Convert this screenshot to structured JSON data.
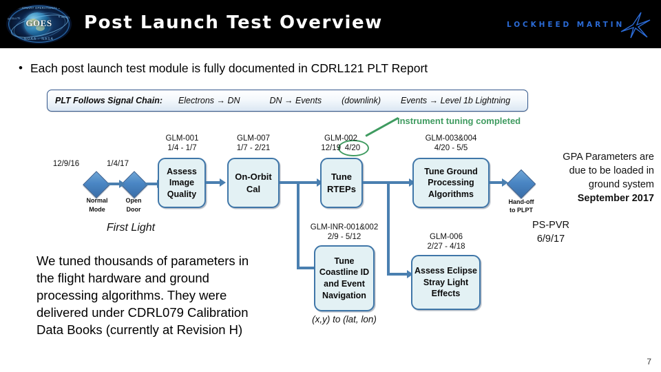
{
  "header": {
    "title": "Post Launch Test Overview",
    "logo_name": "GOES",
    "logo_arc_top": "GEOSTATIONARY  OPERATIONAL  ENVIRONMENTAL  SATELLITE",
    "logo_arc_bottom": "NOAA - NASA",
    "logo_side_left": "SATELLITE",
    "logo_side_right": "R SERIES",
    "brand": "LOCKHEED MARTIN",
    "background_color": "#000000",
    "brand_color": "#2b6bd6"
  },
  "bullet": {
    "marker": "•",
    "text": "Each post launch test module is fully documented in CDRL121 PLT Report"
  },
  "signal_chain": {
    "label": "PLT Follows Signal Chain:",
    "seg1": "Electrons → DN",
    "seg2": "DN → Events",
    "seg3": "(downlink)",
    "seg4": "Events → Level 1b Lightning",
    "border_color": "#33578c"
  },
  "annotation": {
    "instrument_tuning": "Instrument tuning completed",
    "highlight_text": "4/20",
    "color": "#3f9b60"
  },
  "milestones": [
    {
      "date": "12/9/16",
      "label_line1": "Normal",
      "label_line2": "Mode"
    },
    {
      "date": "1/4/17",
      "label_line1": "Open",
      "label_line2": "Door"
    }
  ],
  "first_light": "First Light",
  "handoff": {
    "line1": "Hand-off",
    "line2": "to PLPT"
  },
  "flow_boxes": [
    {
      "id": "assess-image-quality",
      "code": "GLM-001",
      "dates": "1/4 - 1/7",
      "lines": [
        "Assess",
        "Image",
        "Quality"
      ]
    },
    {
      "id": "on-orbit-cal",
      "code": "GLM-007",
      "dates": "1/7 - 2/21",
      "lines": [
        "On-Orbit",
        "Cal"
      ]
    },
    {
      "id": "tune-rteps",
      "code": "GLM-002",
      "dates_prefix": "12/19",
      "dates_highlight": "4/20",
      "lines": [
        "Tune",
        "RTEPs"
      ]
    },
    {
      "id": "tune-ground-processing-algorithms",
      "code": "GLM-003&004",
      "dates": "4/20 - 5/5",
      "lines": [
        "Tune Ground",
        "Processing",
        "Algorithms"
      ]
    },
    {
      "id": "tune-coastline-id-and-event-navigation",
      "code": "GLM-INR-001&002",
      "dates": "2/9 - 5/12",
      "lines": [
        "Tune",
        "Coastline ID",
        "and Event",
        "Navigation"
      ],
      "caption": "(x,y) to (lat, lon)"
    },
    {
      "id": "assess-eclipse-stray-light-effects",
      "code": "GLM-006",
      "dates": "2/27 - 4/18",
      "lines": [
        "Assess Eclipse",
        "Stray Light",
        "Effects"
      ]
    }
  ],
  "side_notes": {
    "gpa_line1": "GPA Parameters are",
    "gpa_line2": "due to be loaded in",
    "gpa_line3": "ground system",
    "gpa_line4": "September 2017",
    "ps_pvr_line1": "PS-PVR",
    "ps_pvr_line2": "6/9/17"
  },
  "body_paragraph": {
    "line1": "We tuned thousands of parameters in",
    "line2": "the flight hardware and ground",
    "line3": "processing algorithms. They were",
    "line4": "delivered under CDRL079 Calibration",
    "line5": "Data Books (currently at Revision H)"
  },
  "page_number": "7",
  "theme": {
    "box_fill": "#e3f1f4",
    "box_border": "#3f76a8",
    "connector": "#4a7fb0",
    "diamond_fill": "#4a86c4"
  }
}
